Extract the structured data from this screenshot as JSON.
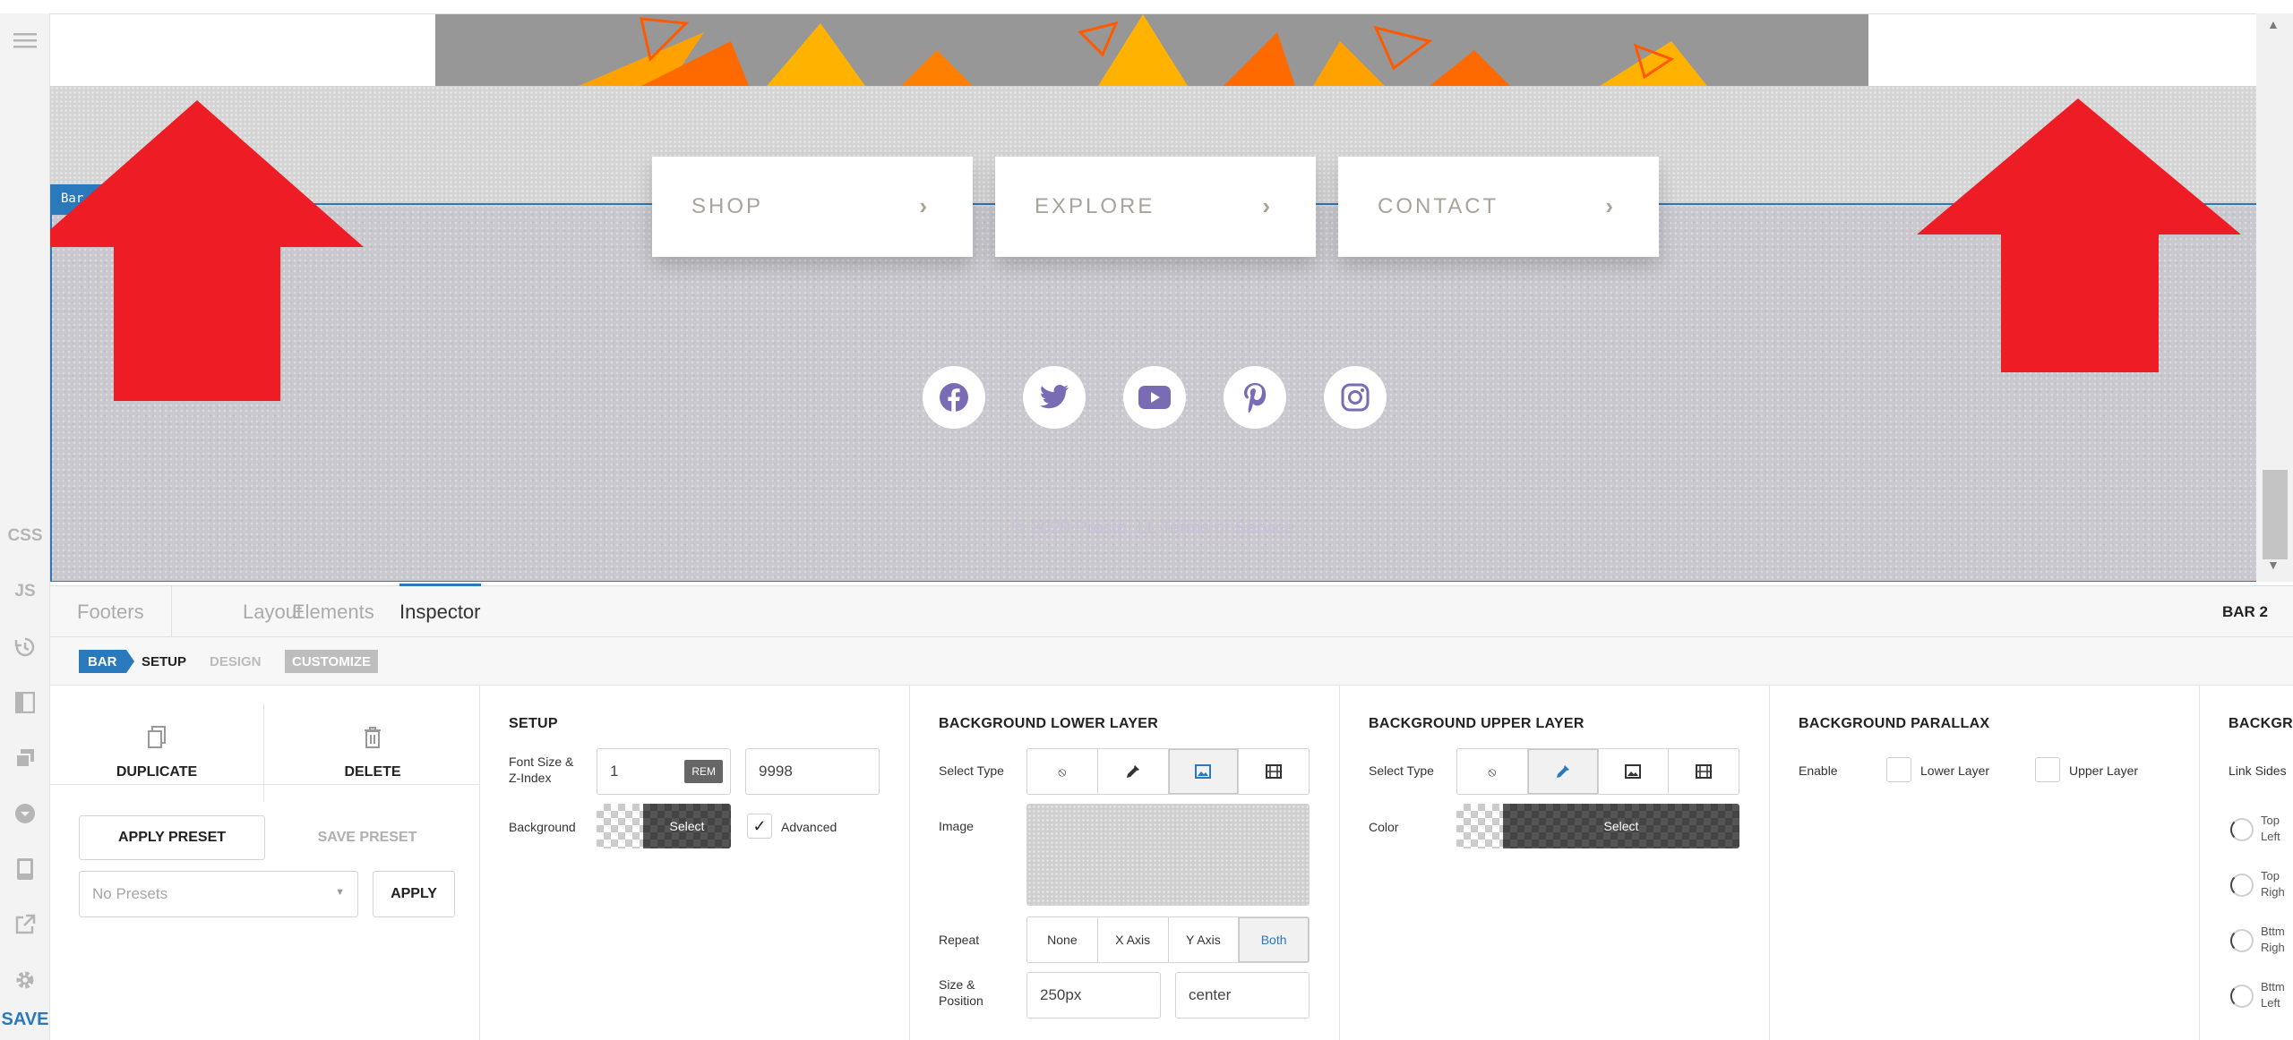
{
  "sidebar": {
    "menu_icon": "hamburger-menu-icon",
    "css_label": "CSS",
    "js_label": "JS",
    "save_label": "SAVE"
  },
  "preview": {
    "bar_tag": "Bar 2",
    "nav_cards": [
      {
        "label": "SHOP",
        "arrow": "›"
      },
      {
        "label": "EXPLORE",
        "arrow": "›"
      },
      {
        "label": "CONTACT",
        "arrow": "›"
      }
    ],
    "social_icons": [
      "facebook-icon",
      "twitter-icon",
      "youtube-icon",
      "pinterest-icon",
      "instagram-icon"
    ],
    "copyright": "© 2020 Prosto. LL Terms of Service",
    "accent_color": "#7a6bb5",
    "arrow_color": "#ee1c25"
  },
  "tabs": {
    "items": [
      "Footers",
      "Layout",
      "Elements",
      "Inspector"
    ],
    "active": "Inspector",
    "bar_label": "BAR 2"
  },
  "breadcrumb": {
    "bar": "BAR",
    "setup": "SETUP",
    "design": "DESIGN",
    "customize": "CUSTOMIZE"
  },
  "actions": {
    "duplicate": "DUPLICATE",
    "delete": "DELETE",
    "apply_preset": "APPLY PRESET",
    "save_preset": "SAVE PRESET",
    "presets_placeholder": "No Presets",
    "apply": "APPLY"
  },
  "setup": {
    "title": "SETUP",
    "font_size_label_1": "Font Size &",
    "font_size_label_2": "Z-Index",
    "font_size_value": "1",
    "font_size_unit": "REM",
    "z_index_value": "9998",
    "background_label": "Background",
    "select_label": "Select",
    "advanced_label": "Advanced",
    "advanced_checked": "✓"
  },
  "bg_lower": {
    "title": "BACKGROUND LOWER LAYER",
    "select_type_label": "Select Type",
    "image_label": "Image",
    "repeat_label": "Repeat",
    "repeat_options": [
      "None",
      "X Axis",
      "Y Axis",
      "Both"
    ],
    "repeat_selected": "Both",
    "size_label_1": "Size &",
    "size_label_2": "Position",
    "size_value": "250px",
    "position_value": "center"
  },
  "bg_upper": {
    "title": "BACKGROUND UPPER LAYER",
    "select_type_label": "Select Type",
    "color_label": "Color",
    "select_label": "Select"
  },
  "parallax": {
    "title": "BACKGROUND PARALLAX",
    "enable_label": "Enable",
    "lower_label": "Lower Layer",
    "upper_label": "Upper Layer"
  },
  "corners": {
    "title": "BACKGR",
    "link_label": "Link Sides",
    "items": [
      {
        "line1": "Top",
        "line2": "Left"
      },
      {
        "line1": "Top",
        "line2": "Righ"
      },
      {
        "line1": "Bttm",
        "line2": "Righ"
      },
      {
        "line1": "Bttm",
        "line2": "Left"
      }
    ]
  }
}
